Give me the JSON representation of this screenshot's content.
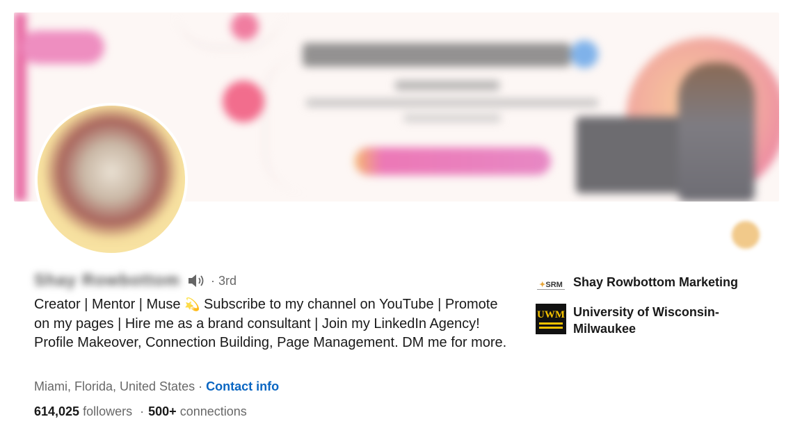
{
  "profile": {
    "name": "Shay Rowbottom",
    "degree": "· 3rd",
    "headline_part1": "Creator | Mentor | Muse ",
    "headline_emoji": "💫",
    "headline_part2": " Subscribe to my channel on YouTube | Promote on my pages | Hire me as a brand consultant | Join my LinkedIn Agency! Profile Makeover, Connection Building, Page Management. DM me for more.",
    "location": "Miami, Florida, United States",
    "location_sep": " · ",
    "contact_label": "Contact info",
    "followers_count": "614,025",
    "followers_label": "followers",
    "stats_sep": "·",
    "connections_count": "500+",
    "connections_label": "connections"
  },
  "organizations": [
    {
      "name": "Shay Rowbottom Marketing",
      "logo_text": "SRM",
      "logo_icon": "srm-logo"
    },
    {
      "name": "University of Wisconsin-Milwaukee",
      "logo_text": "UWM",
      "logo_icon": "uwm-logo"
    }
  ],
  "icons": {
    "name_pronunciation": "speaker-icon"
  },
  "colors": {
    "link": "#0a66c2",
    "banner_accent": "#ea6fa5",
    "uwm_gold": "#f5c200"
  }
}
